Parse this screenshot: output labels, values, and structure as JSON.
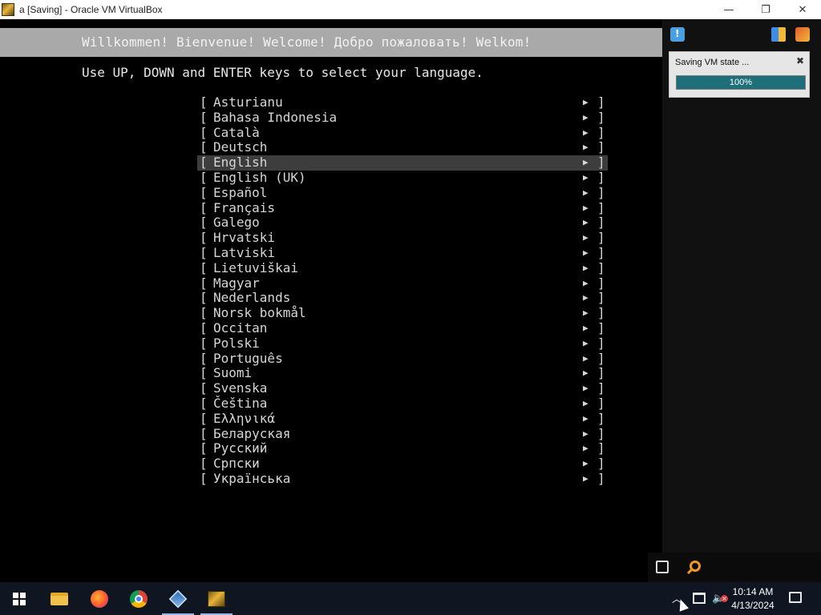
{
  "window": {
    "title": "a [Saving] - Oracle VM VirtualBox",
    "minimize": "—",
    "restore": "❐",
    "close": "✕"
  },
  "vm": {
    "header": "Willkommen! Bienvenue! Welcome! Добро пожаловать! Welkom!",
    "instruction": "Use UP, DOWN and ENTER keys to select your language.",
    "selected_language": "English",
    "left_bracket": "[",
    "right_bracket": "]",
    "arrow": "▶",
    "languages": [
      "Asturianu",
      "Bahasa Indonesia",
      "Català",
      "Deutsch",
      "English",
      "English (UK)",
      "Español",
      "Français",
      "Galego",
      "Hrvatski",
      "Latviski",
      "Lietuviškai",
      "Magyar",
      "Nederlands",
      "Norsk bokmål",
      "Occitan",
      "Polski",
      "Português",
      "Suomi",
      "Svenska",
      "Čeština",
      "Ελληνικά",
      "Беларуская",
      "Русский",
      "Српски",
      "Українська"
    ]
  },
  "popup": {
    "title": "Saving VM state ...",
    "close": "✖",
    "progress_percent": 100,
    "progress_text": "100%"
  },
  "taskbar": {
    "apps": [
      "start",
      "file-explorer",
      "firefox",
      "chrome",
      "virtualbox",
      "vm-window"
    ],
    "active_apps": [
      "virtualbox",
      "vm-window"
    ],
    "tray_chevron": "︿",
    "clock_time": "10:14 AM",
    "clock_date": "4/13/2024"
  },
  "colors": {
    "vm_header_bg": "#a9a9a9",
    "selection_bg": "#3d3d3d",
    "progress_fill": "#1f6f7a",
    "taskbar_bg": "#101522"
  }
}
